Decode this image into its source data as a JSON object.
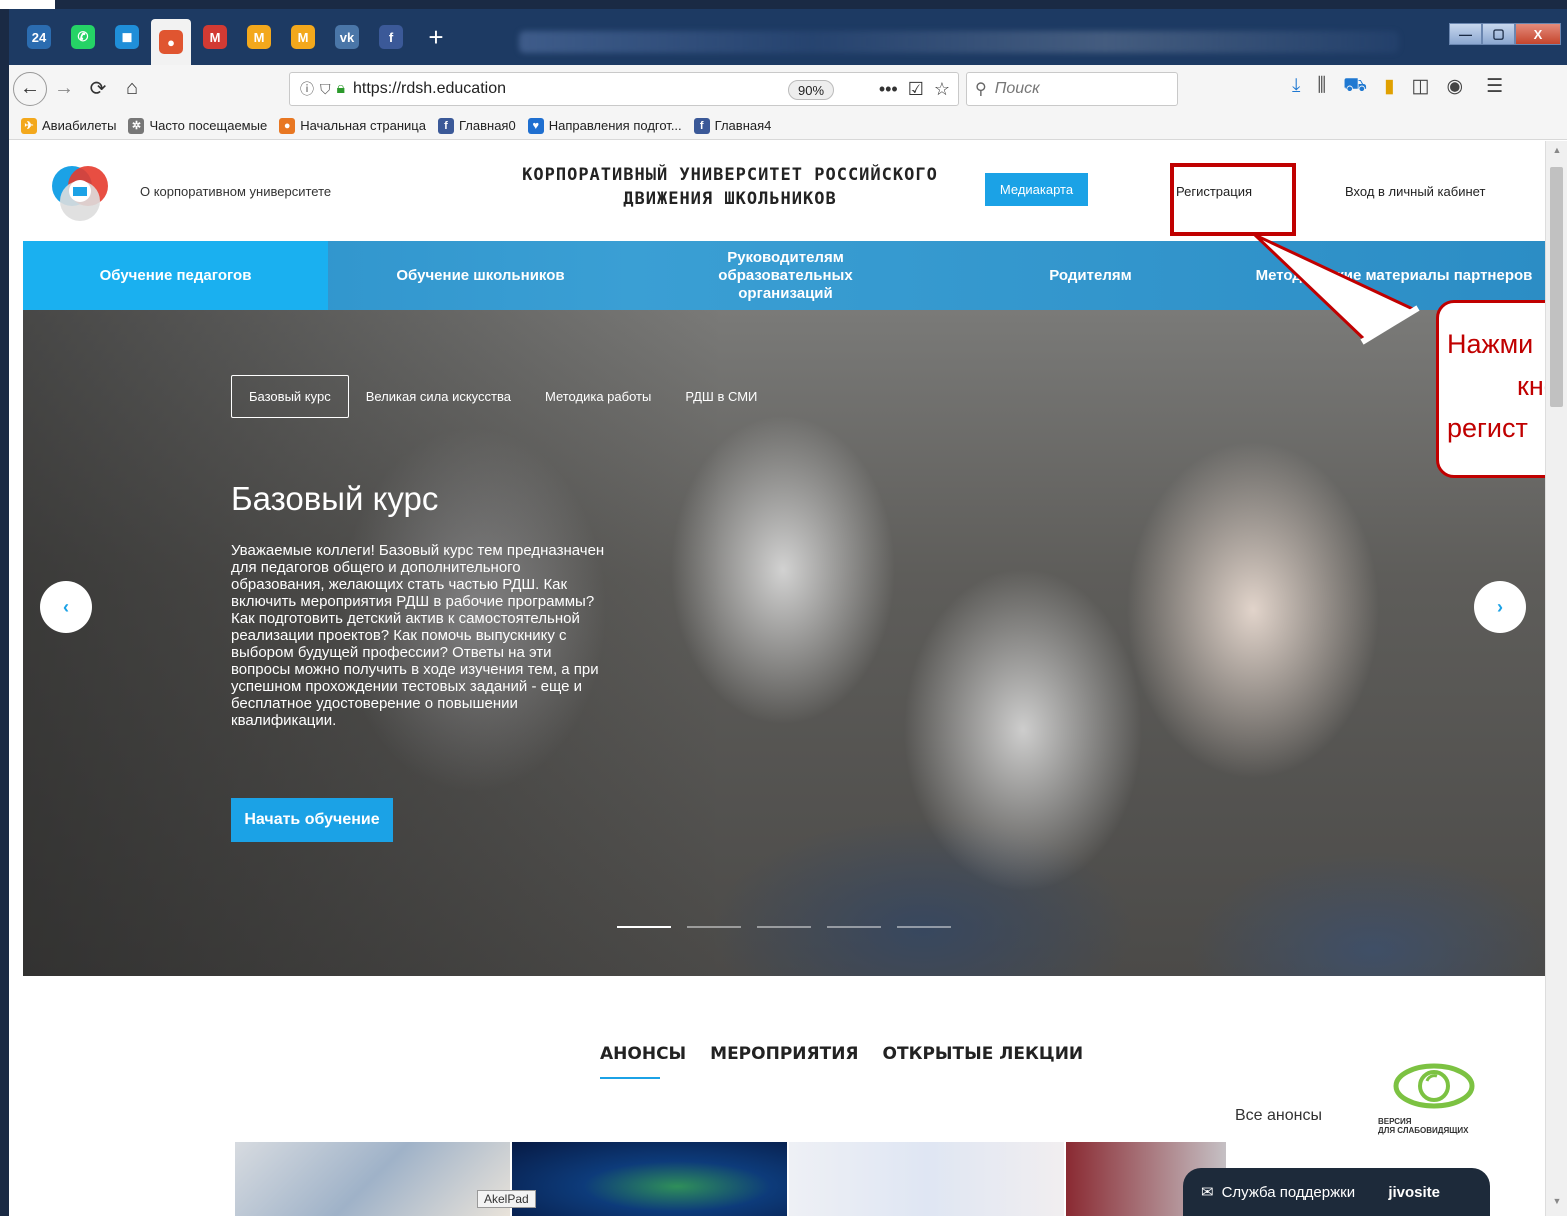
{
  "browser": {
    "tabs": [
      {
        "name": "tab-24",
        "glyph": "24",
        "color": "#2b6cb0"
      },
      {
        "name": "tab-whatsapp",
        "glyph": "✆",
        "color": "#25d366"
      },
      {
        "name": "tab-blue",
        "glyph": "◼",
        "color": "#1f8ed8"
      },
      {
        "name": "tab-rdsh",
        "glyph": "●",
        "color": "#e05530",
        "active": true
      },
      {
        "name": "tab-mail1",
        "glyph": "M",
        "color": "#d23a33"
      },
      {
        "name": "tab-mail2",
        "glyph": "M",
        "color": "#f3a81c"
      },
      {
        "name": "tab-mail3",
        "glyph": "M",
        "color": "#f3a81c"
      },
      {
        "name": "tab-vk",
        "glyph": "vk",
        "color": "#4a76a8"
      },
      {
        "name": "tab-facebook",
        "glyph": "f",
        "color": "#3b5998"
      }
    ],
    "new_tab": "+",
    "window_controls": {
      "minimize": "—",
      "maximize": "▢",
      "close": "X"
    },
    "url": "https://rdsh.education",
    "zoom": "90%",
    "url_actions": {
      "more": "•••",
      "pocket": "☑",
      "star": "☆"
    },
    "search_placeholder": "Поиск",
    "bookmarks": [
      {
        "label": "Авиабилеты",
        "icon_color": "#f3a81c",
        "glyph": "✈"
      },
      {
        "label": "Часто посещаемые",
        "icon_color": "#777777",
        "glyph": "✲"
      },
      {
        "label": "Начальная страница",
        "icon_color": "#e87722",
        "glyph": "●"
      },
      {
        "label": "Главная0",
        "icon_color": "#3b5998",
        "glyph": "f"
      },
      {
        "label": "Направления подгот...",
        "icon_color": "#1f6fd0",
        "glyph": "♥"
      },
      {
        "label": "Главная4",
        "icon_color": "#3b5998",
        "glyph": "f"
      }
    ]
  },
  "site": {
    "about": "О корпоративном университете",
    "title_line1": "КОРПОРАТИВНЫЙ УНИВЕРСИТЕТ РОССИЙСКОГО",
    "title_line2": "ДВИЖЕНИЯ ШКОЛЬНИКОВ",
    "media_button": "Медиакарта",
    "register": "Регистрация",
    "login": "Вход в личный кабинет",
    "nav": [
      {
        "label": "Обучение педагогов",
        "active": true
      },
      {
        "label": "Обучение школьников"
      },
      {
        "label": "Руководителям образовательных организаций"
      },
      {
        "label": "Родителям"
      },
      {
        "label": "Методические материалы партнеров"
      }
    ],
    "hero": {
      "tabs": [
        "Базовый курс",
        "Великая сила искусства",
        "Методика работы",
        "РДШ в СМИ"
      ],
      "title": "Базовый курс",
      "text": "Уважаемые коллеги! Базовый курс тем предназначен для педагогов общего и дополнительного образования, желающих стать частью РДШ. Как включить мероприятия РДШ в рабочие программы? Как подготовить детский актив к самостоятельной реализации проектов? Как помочь выпускнику с выбором будущей профессии? Ответы на эти вопросы можно получить в ходе изучения тем, а при успешном прохождении тестовых заданий - еще и бесплатное удостоверение о повышении квалификации.",
      "cta": "Начать обучение",
      "prev": "‹",
      "next": "›"
    },
    "section_tabs": [
      "АНОНСЫ",
      "МЕРОПРИЯТИЯ",
      "ОТКРЫТЫЕ ЛЕКЦИИ"
    ],
    "all_announcements": "Все анонсы",
    "low_vision_line1": "ВЕРСИЯ",
    "low_vision_line2": "ДЛЯ СЛАБОВИДЯЩИХ",
    "akelpad": "AkelPad",
    "support": "Служба поддержки",
    "jivosite": "jivosite"
  },
  "annotation": {
    "line1": "Нажми",
    "line2": "кно",
    "line3": "регист",
    "color": "#c00000"
  }
}
